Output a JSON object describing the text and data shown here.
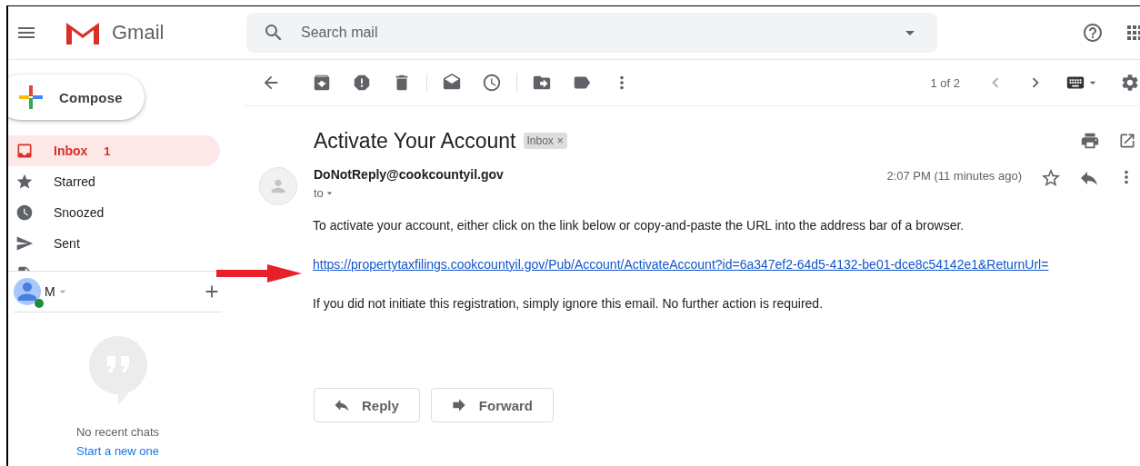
{
  "header": {
    "product": "Gmail",
    "search": {
      "placeholder": "Search mail"
    }
  },
  "compose": {
    "label": "Compose"
  },
  "nav": [
    {
      "kind": "inbox",
      "label": "Inbox",
      "count": "1",
      "selected": true
    },
    {
      "kind": "star",
      "label": "Starred",
      "selected": false
    },
    {
      "kind": "clock",
      "label": "Snoozed",
      "selected": false
    },
    {
      "kind": "send",
      "label": "Sent",
      "selected": false
    },
    {
      "kind": "draft",
      "selected": false
    }
  ],
  "chat": {
    "user": "M",
    "online": true,
    "empty_text": "No recent chats",
    "link": "Start a new one"
  },
  "toolbar": {
    "pager": "1 of 2"
  },
  "message": {
    "subject": "Activate Your Account",
    "label": "Inbox",
    "label_close": "×",
    "sender": "DoNotReply@cookcountyil.gov",
    "recipient_label": "to",
    "time": "2:07 PM (11 minutes ago)",
    "starred": false,
    "body": [
      {
        "kind": "text",
        "text": "To activate your account, either click on the link below or copy-and-paste the URL into the address bar of a browser."
      },
      {
        "kind": "link",
        "text": "https://propertytaxfilings.cookcountyil.gov/Pub/Account/ActivateAccount?id=6a347ef2-64d5-4132-be01-dce8c54142e1&ReturnUrl="
      },
      {
        "kind": "text",
        "text": "If you did not initiate this registration, simply ignore this email.  No further action is required."
      }
    ]
  },
  "actions": [
    {
      "kind": "reply",
      "label": "Reply"
    },
    {
      "kind": "forward",
      "label": "Forward"
    }
  ],
  "annotation": {
    "arrow": true
  }
}
